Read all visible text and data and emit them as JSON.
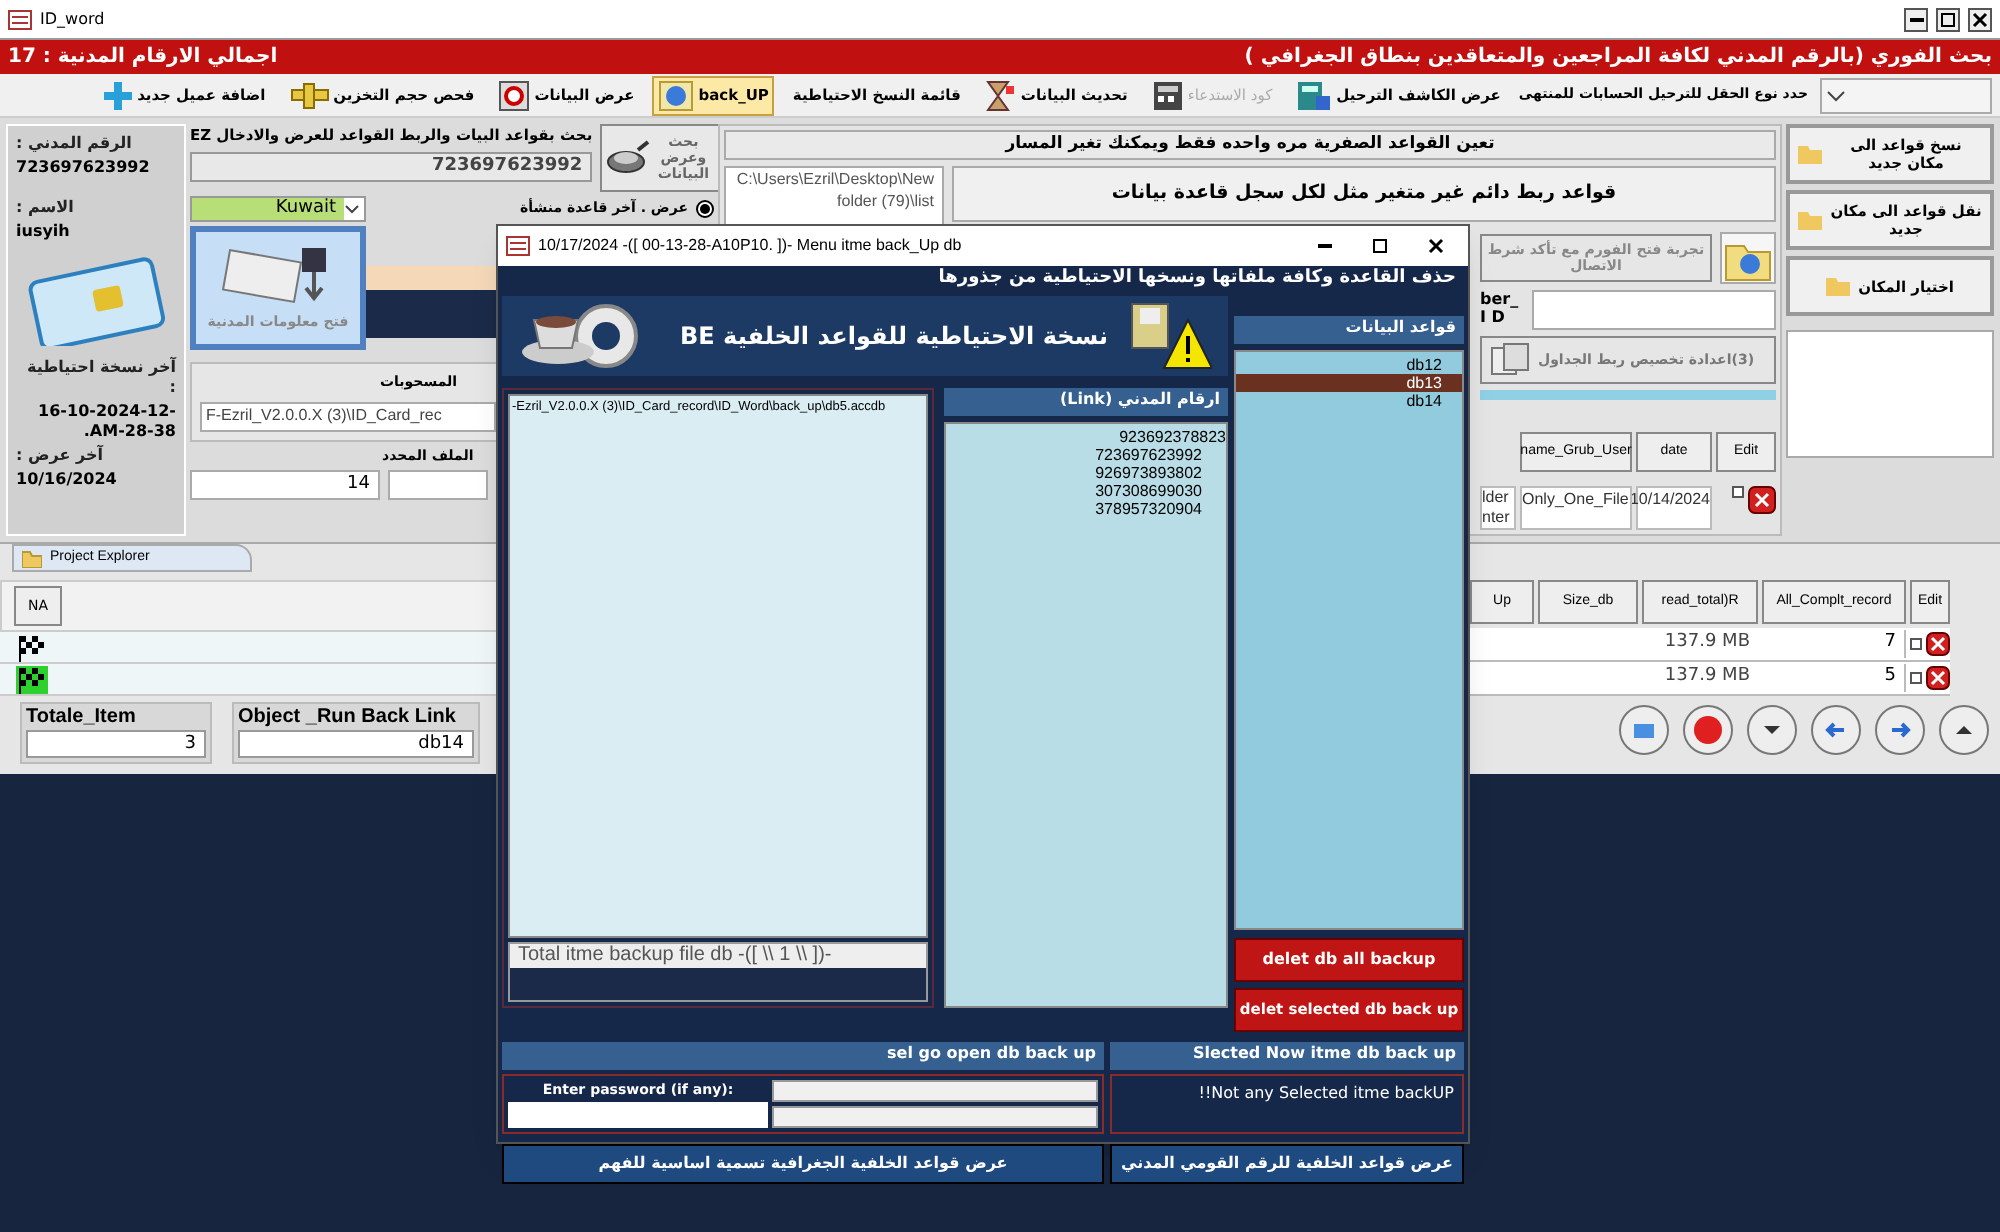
{
  "window": {
    "title": "ID_word"
  },
  "header_bar": {
    "search_title": "بحث الفوري (بالرقم المدني لكافة المراجعين والمتعاقدين بنطاق الجغرافي )",
    "total_label": "اجمالي الارقام المدنية : 17"
  },
  "field_type_combo": {
    "label": "حدد نوع الحقل للترحيل الحسابات للمنتهى"
  },
  "toolbar": [
    {
      "label": "عرض الكاشف الترحيل",
      "selected": false,
      "disabled": false
    },
    {
      "label": "كود الاستدعاء",
      "selected": false,
      "disabled": true
    },
    {
      "label": "تحديث البيانات",
      "selected": false,
      "disabled": false
    },
    {
      "label": "قائمة النسخ الاحتياطية",
      "selected": false,
      "disabled": false
    },
    {
      "label": "back_UP",
      "selected": true,
      "disabled": false
    },
    {
      "label": "عرض البيانات",
      "selected": false,
      "disabled": false
    },
    {
      "label": "فحص حجم التخزين",
      "selected": false,
      "disabled": false
    },
    {
      "label": "اضافة عميل جديد",
      "selected": false,
      "disabled": false
    }
  ],
  "person": {
    "civil_label": "الرقم المدني :",
    "civil_number": "723697623992",
    "name_label": "الاسم :",
    "name": "iusyih",
    "last_backup_label": "آخر نسخة احتياطية :",
    "last_backup": "16-10-2024-12-28-38-AM.",
    "last_view_label": "آخر عرض :",
    "last_view": "10/16/2024"
  },
  "search_panel": {
    "title": "بحث بقواعد البيات والربط القواعد للعرض والادخال EZ",
    "search_value": "723697623992",
    "search_button": "بحث وعرض البيانات",
    "country": "Kuwait",
    "radio_label": "عرض . آخر قاعدة منشأة",
    "radio_checked": true,
    "open_button": "فتح معلومات المدنية",
    "withdrawals_label": "المسحوبات",
    "path_value": "F-Ezril_V2.0.0.X (3)\\ID_Card_rec",
    "selected_file_label": "الملف المحدد",
    "selected_file_value": "14"
  },
  "links_panel": {
    "zero_title": "تعين القواعد الصفرية مره واحده فقط ويمكنك تغير المسار",
    "path": "C:\\Users\\Ezril\\Desktop\\New folder (79)\\list",
    "permanent_title": "قواعد ربط دائم غير متغير مثل لكل سجل قاعدة بيانات",
    "test_button": "تجربة فتح الفورم مع تأكد شرط الاتصال",
    "number_label": "ber_I D",
    "remap_button": "(3)اعدادة تخصيص ربط الجداول",
    "table": {
      "columns": [
        "Edit",
        "date",
        "name_Grub_User"
      ],
      "rows": [
        {
          "cells": [
            "",
            "10/14/2024",
            "Only_One_File",
            "lder nter"
          ],
          "checked": false
        }
      ]
    }
  },
  "right_buttons": [
    "نسخ قواعد الى مكان جديد",
    "نقل قواعد الى مكان جديد",
    "اختيار المكان"
  ],
  "project_explorer": {
    "title": "Project Explorer",
    "column": "NA",
    "rows": [
      {
        "selected": false
      },
      {
        "selected": true
      }
    ]
  },
  "totals": {
    "total_label": "Totale_Item",
    "total_value": "3",
    "object_label": "Object _Run Back Link",
    "object_value": "db14"
  },
  "records_table": {
    "columns": [
      "Edit",
      "All_Complt_record",
      "read_total)R",
      "Size_db",
      "Up"
    ],
    "rows": [
      {
        "count": "7",
        "size": "137.9 MB",
        "checked": false
      },
      {
        "count": "5",
        "size": "137.9 MB",
        "checked": false
      }
    ]
  },
  "dialog": {
    "title": "10/17/2024 -([ 00-13-28-A10P10. ])- Menu itme back_Up db",
    "header": "حذف القاعدة وكافة ملفاتها ونسخها الاحتياطية من جذورها",
    "banner": "نسخة الاحتياطية للقواعد الخلفية  BE",
    "databases": {
      "title": "قواعد البيانات",
      "items": [
        {
          "label": "db12",
          "selected": false
        },
        {
          "label": "db13",
          "selected": true
        },
        {
          "label": "db14",
          "selected": false
        }
      ]
    },
    "civil_links": {
      "title": "ارقام المدني (Link)",
      "items": [
        "923692378823",
        "723697623992",
        "926973893802",
        "307308699030",
        "378957320904"
      ]
    },
    "backup_files": {
      "items": [
        "-Ezril_V2.0.0.X (3)\\ID_Card_record\\ID_Word\\back_up\\db5.accdb"
      ],
      "total": "Total itme backup file db -([ \\\\ 1 \\\\ ])-"
    },
    "delete_all_button": "delet db all backup",
    "delete_selected_button": "delet selected db back up",
    "selected_title": "Slected Now itme db back up",
    "open_title": "sel go open db back up",
    "selected_message": "!!Not any Selected itme backUP",
    "password_label": "Enter password (if any):",
    "buttons": [
      "عرض قواعد الخلفية للرقم القومي المدني",
      "عرض قواعد الخلفية الجغرافية تسمية اساسية للفهم"
    ]
  }
}
